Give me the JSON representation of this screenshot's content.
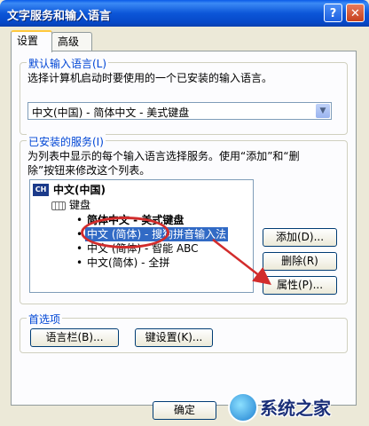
{
  "window": {
    "title": "文字服务和输入语言",
    "help_glyph": "?",
    "close_glyph": "✕"
  },
  "tabs": [
    {
      "label": "设置"
    },
    {
      "label": "高级"
    }
  ],
  "default_lang": {
    "group_title": "默认输入语言(L)",
    "description": "选择计算机启动时要使用的一个已安装的输入语言。",
    "selected_value": "中文(中国) - 简体中文 - 美式键盘"
  },
  "installed": {
    "group_title": "已安装的服务(I)",
    "description_line1": "为列表中显示的每个输入语言选择服务。使用“添加”和“删",
    "description_line2": "除”按钮来修改这个列表。",
    "language_badge": "CH",
    "language": "中文(中国)",
    "category": "键盘",
    "services": [
      {
        "label": "简体中文 - 美式键盘",
        "bold": true,
        "selected": false
      },
      {
        "label": "中文 (简体) - 搜狗拼音输入法",
        "bold": false,
        "selected": true
      },
      {
        "label": "中文 (简体) - 智能 ABC",
        "bold": false,
        "selected": false
      },
      {
        "label": "中文(简体) - 全拼",
        "bold": false,
        "selected": false
      }
    ],
    "add_label": "添加(D)...",
    "remove_label": "删除(R)",
    "properties_label": "属性(P)..."
  },
  "preferences": {
    "group_title": "首选项",
    "language_bar_label": "语言栏(B)...",
    "key_settings_label": "键设置(K)..."
  },
  "footer": {
    "ok_label": "确定"
  },
  "watermark": {
    "text": "系统之家"
  },
  "colors": {
    "annotation": "#d22c2c",
    "selection": "#316ac5",
    "group_title": "#0046d5",
    "titlebar": "#0a5ae8"
  }
}
